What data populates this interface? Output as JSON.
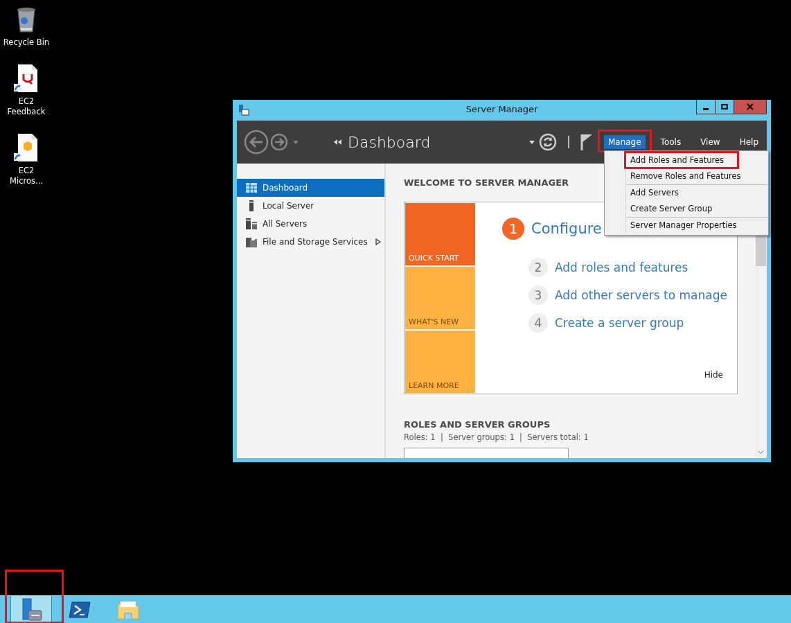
{
  "desktop_icons": [
    {
      "kind": "recycle-bin",
      "label": "Recycle Bin"
    },
    {
      "kind": "feedback",
      "label": "EC2\nFeedback"
    },
    {
      "kind": "package",
      "label": "EC2\nMicros..."
    }
  ],
  "window": {
    "title": "Server Manager",
    "header": {
      "breadcrumb": "Dashboard",
      "menus": [
        {
          "label": "Manage",
          "selected": true,
          "highlighted": true
        },
        {
          "label": "Tools",
          "selected": false,
          "highlighted": false
        },
        {
          "label": "View",
          "selected": false,
          "highlighted": false
        },
        {
          "label": "Help",
          "selected": false,
          "highlighted": false
        }
      ]
    },
    "dropdown": {
      "groups": [
        [
          {
            "label": "Add Roles and Features",
            "highlighted": true
          },
          {
            "label": "Remove Roles and Features",
            "highlighted": false
          }
        ],
        [
          {
            "label": "Add Servers",
            "highlighted": false
          },
          {
            "label": "Create Server Group",
            "highlighted": false
          }
        ],
        [
          {
            "label": "Server Manager Properties",
            "highlighted": false
          }
        ]
      ]
    },
    "sidebar": {
      "items": [
        {
          "kind": "dashboard",
          "label": "Dashboard",
          "selected": true,
          "has_submenu": false
        },
        {
          "kind": "server",
          "label": "Local Server",
          "selected": false,
          "has_submenu": false
        },
        {
          "kind": "servers",
          "label": "All Servers",
          "selected": false,
          "has_submenu": false
        },
        {
          "kind": "storage",
          "label": "File and Storage Services",
          "selected": false,
          "has_submenu": true
        }
      ]
    },
    "welcome": {
      "heading": "WELCOME TO SERVER MANAGER",
      "tiles": [
        {
          "label": "QUICK START",
          "selected": true
        },
        {
          "label": "WHAT'S NEW",
          "selected": false
        },
        {
          "label": "LEARN MORE",
          "selected": false
        }
      ],
      "steps": [
        {
          "number": "1",
          "text": "Configure",
          "active": true
        },
        {
          "number": "2",
          "text": "Add roles and features",
          "active": false
        },
        {
          "number": "3",
          "text": "Add other servers to manage",
          "active": false
        },
        {
          "number": "4",
          "text": "Create a server group",
          "active": false
        }
      ],
      "hide_link": "Hide"
    },
    "roles": {
      "heading": "ROLES AND SERVER GROUPS",
      "summary": "Roles: 1  |  Server groups: 1  |  Servers total: 1"
    }
  },
  "taskbar": {
    "items": [
      {
        "kind": "server-manager",
        "selected": true,
        "highlighted": true
      },
      {
        "kind": "powershell",
        "selected": false,
        "highlighted": false
      },
      {
        "kind": "explorer",
        "selected": false,
        "highlighted": false
      }
    ]
  }
}
